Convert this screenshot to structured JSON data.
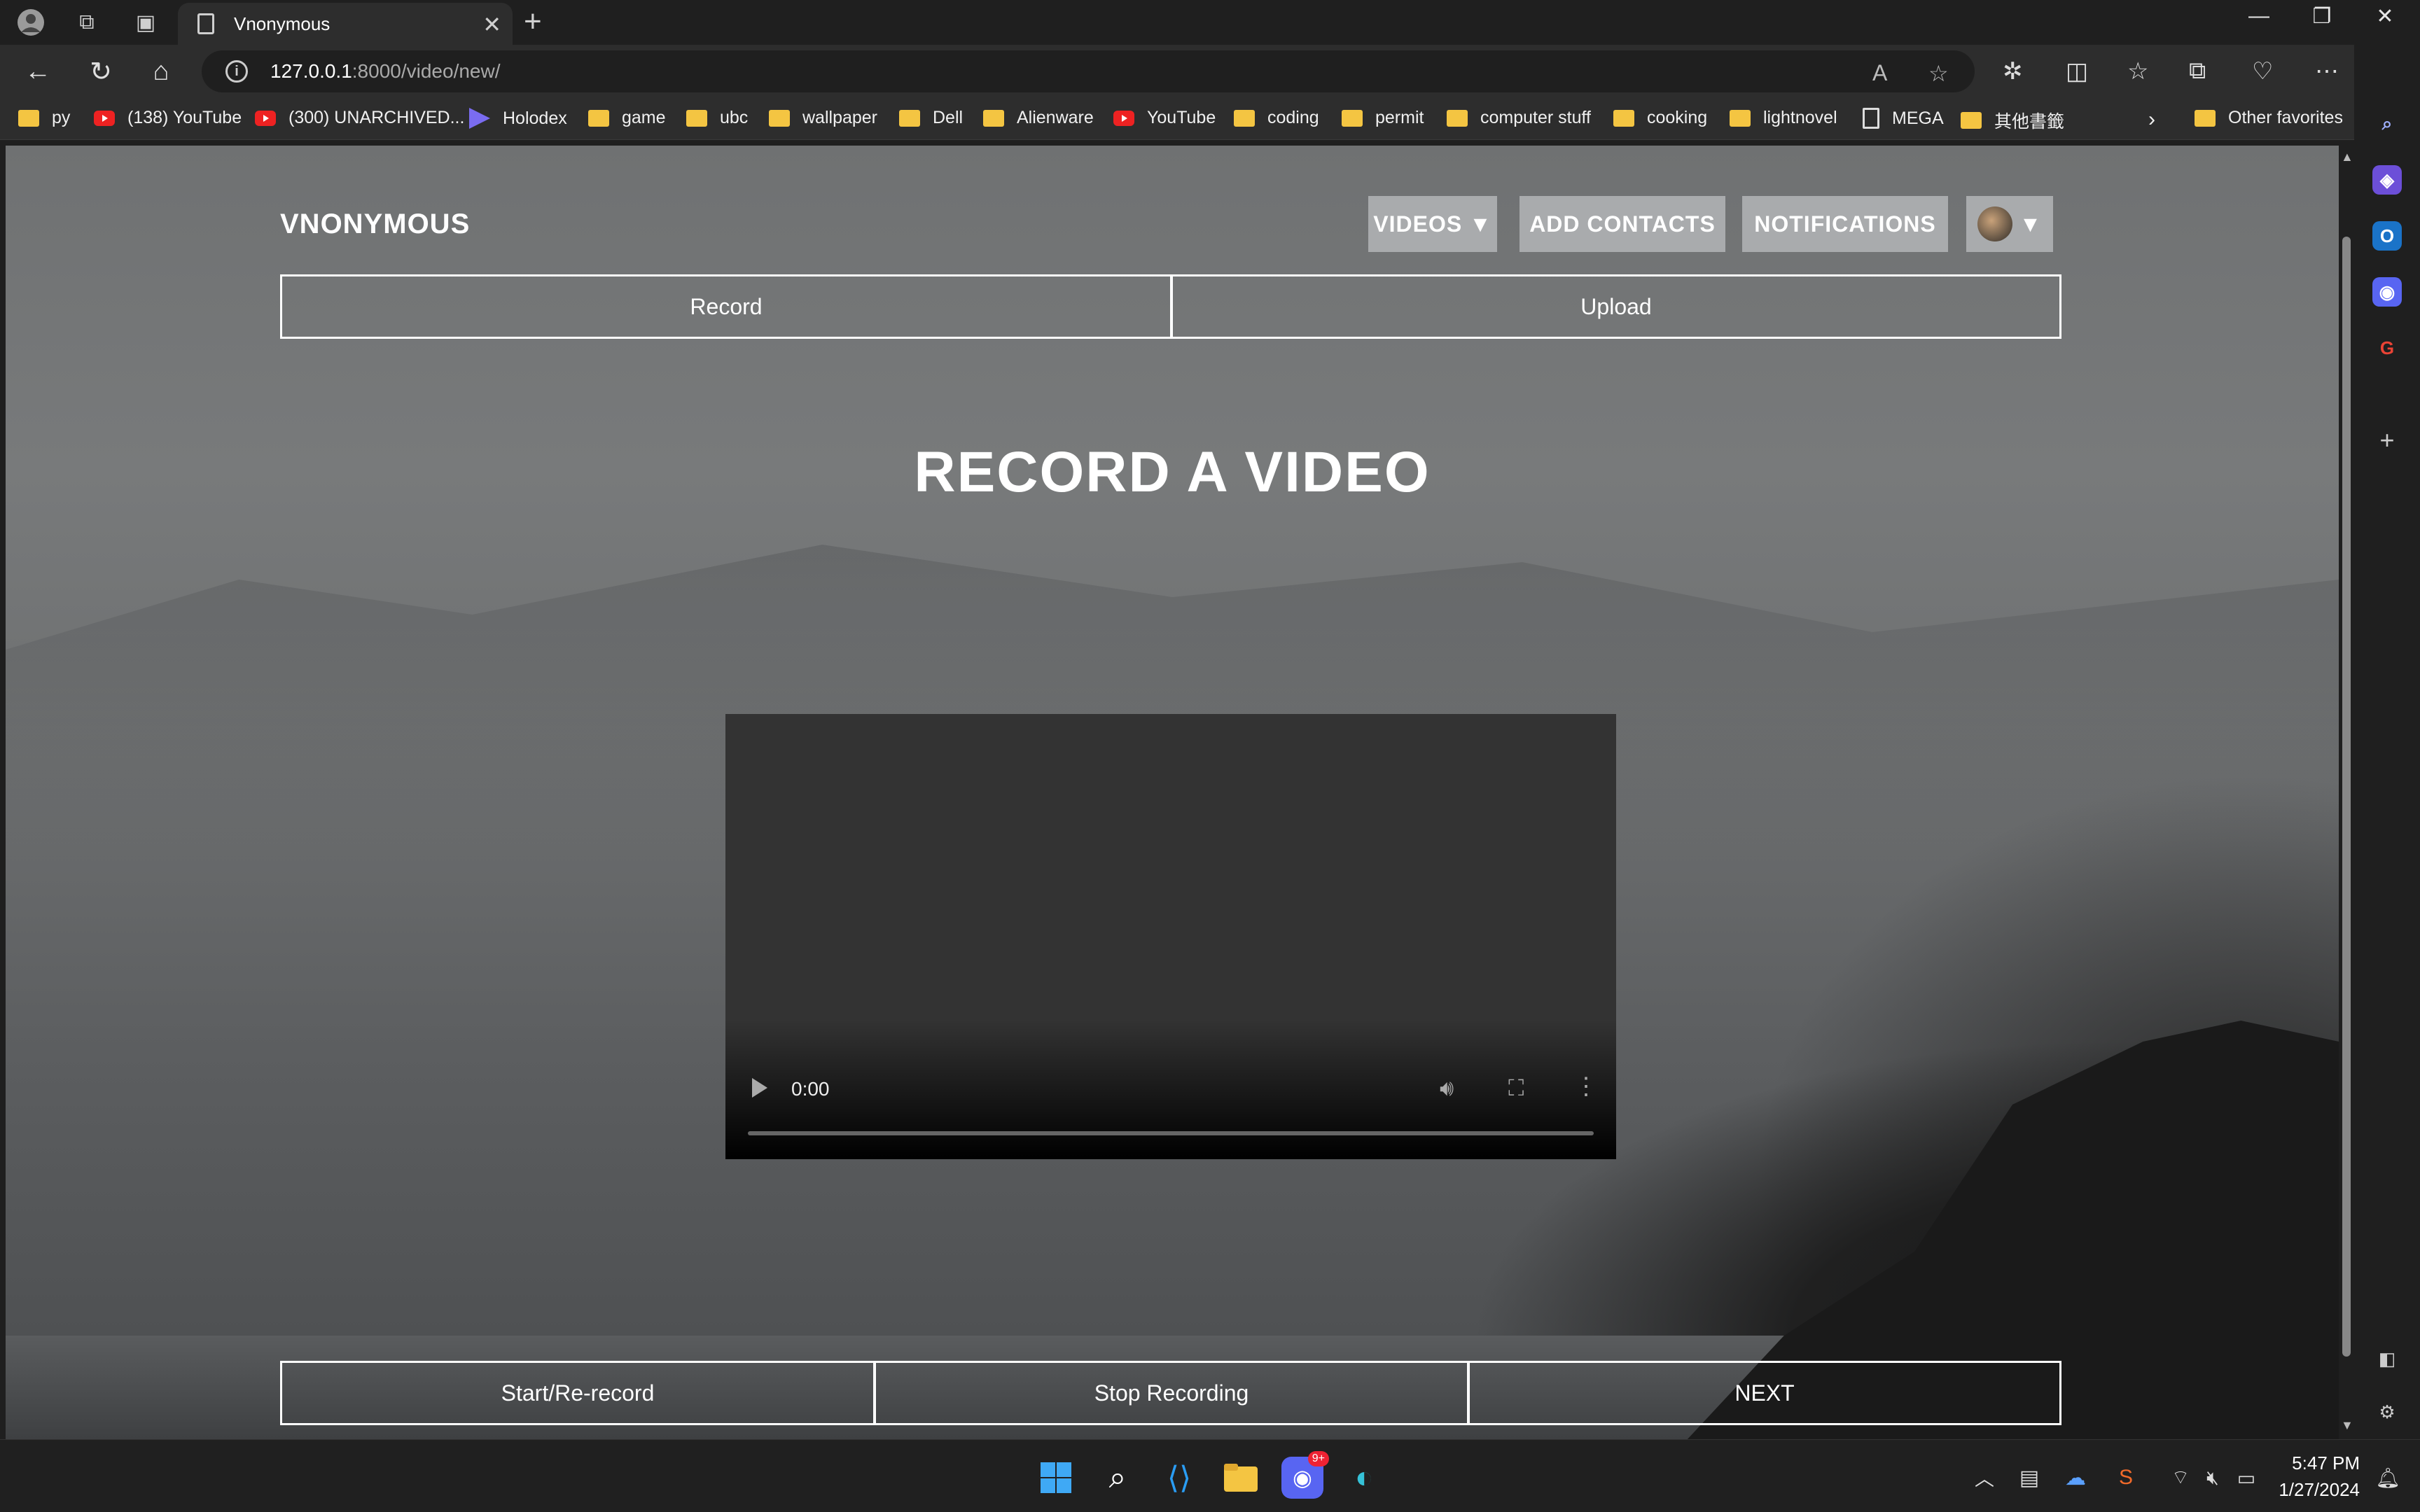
{
  "browser": {
    "tab_title": "Vnonymous",
    "url_host": "127.0.0.1",
    "url_rest": ":8000/video/new/",
    "bookmarks": [
      "py",
      "(138) YouTube",
      "(300) UNARCHIVED...",
      "Holodex",
      "game",
      "ubc",
      "wallpaper",
      "Dell",
      "Alienware",
      "YouTube",
      "coding",
      "permit",
      "computer stuff",
      "cooking",
      "lightnovel",
      "MEGA",
      "其他書籤"
    ],
    "other_favorites": "Other favorites"
  },
  "site": {
    "brand": "VNONYMOUS",
    "nav": {
      "videos": "VIDEOS ▼",
      "add_contacts": "ADD CONTACTS",
      "notifications": "NOTIFICATIONS",
      "avatar_caret": "▼"
    },
    "mode_tabs": {
      "record": "Record",
      "upload": "Upload"
    },
    "heading": "RECORD A VIDEO",
    "player": {
      "time": "0:00"
    },
    "actions": {
      "start": "Start/Re-record",
      "stop": "Stop Recording",
      "next": "NEXT"
    }
  },
  "taskbar": {
    "time": "5:47 PM",
    "date": "1/27/2024",
    "discord_badge": "9+"
  },
  "icons": [
    "profile-icon",
    "workspaces-icon",
    "tab-actions-icon",
    "back-icon",
    "refresh-icon",
    "home-icon",
    "info-icon",
    "read-aloud-icon",
    "favorite-star-icon",
    "extensions-icon",
    "split-screen-icon",
    "favorites-icon",
    "collections-icon",
    "browser-essentials-icon",
    "more-icon",
    "copilot-icon"
  ],
  "colors": {
    "nav_button_bg": "#a9abad",
    "video_bg": "#333333",
    "brand_text": "#ffffff"
  }
}
